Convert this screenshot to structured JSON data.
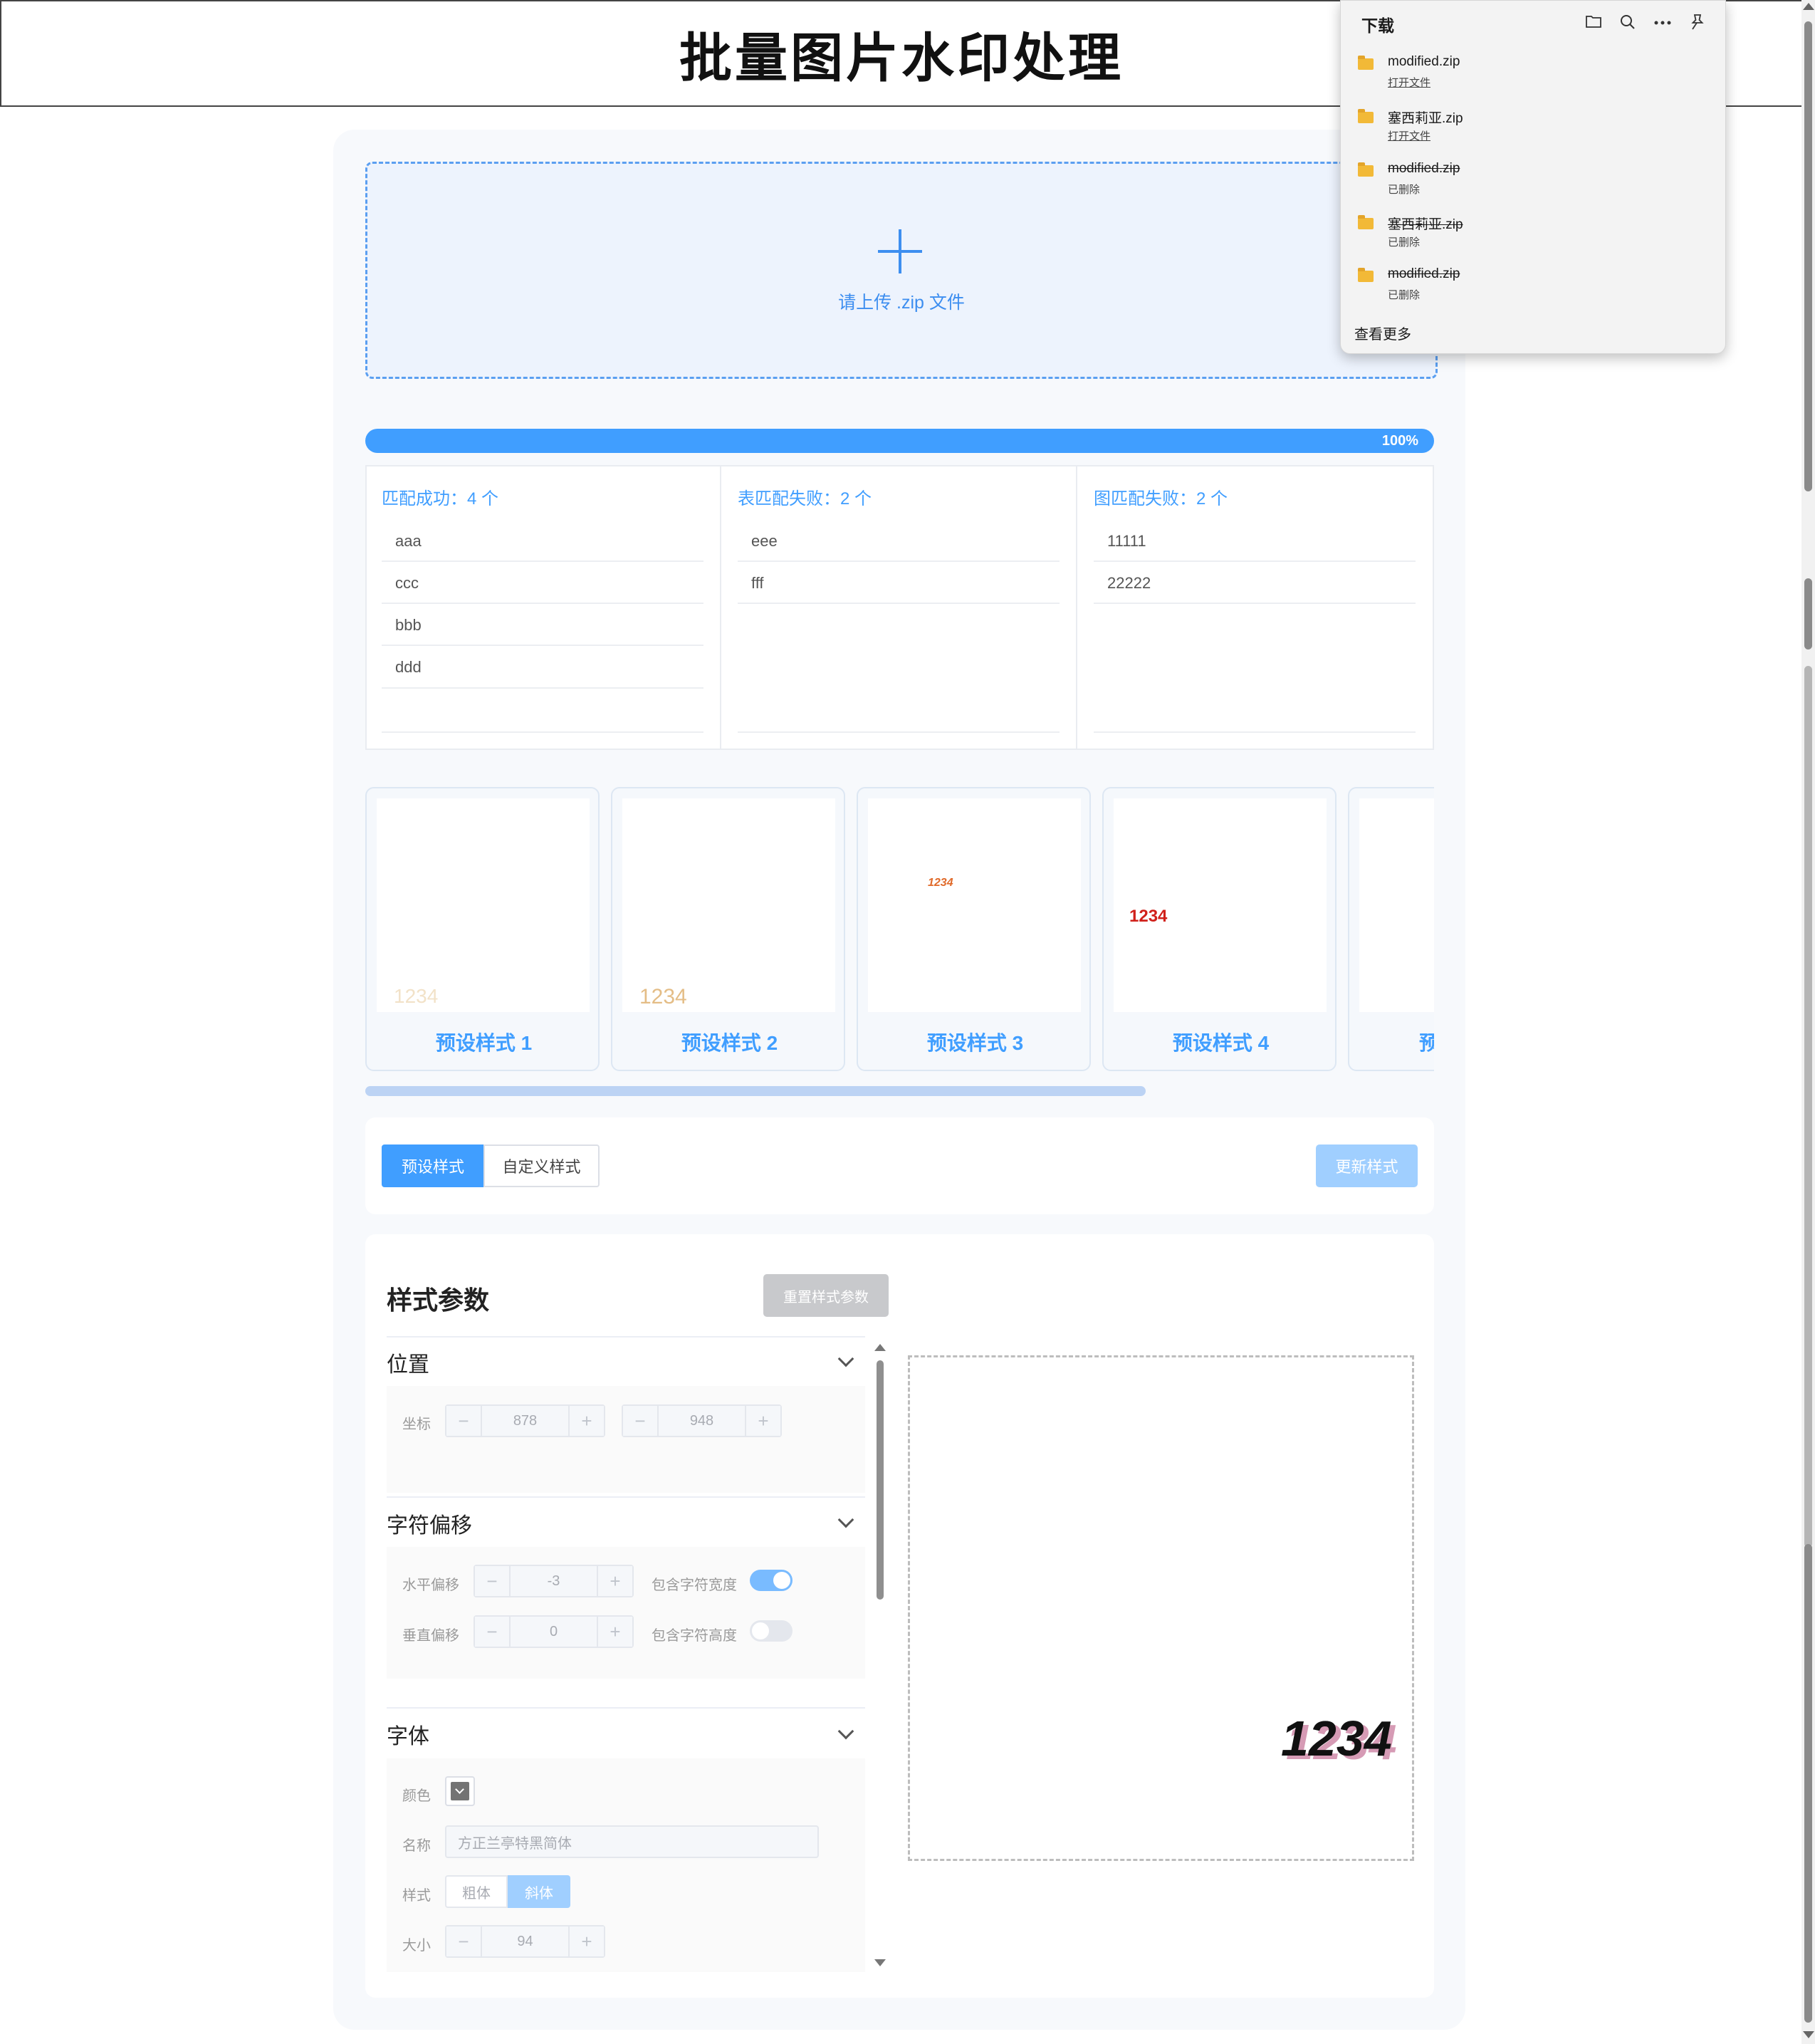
{
  "page": {
    "title": "批量图片水印处理"
  },
  "upload": {
    "text": "请上传 .zip 文件"
  },
  "progress": {
    "percent": 100,
    "label": "100%"
  },
  "match": {
    "success": {
      "title": "匹配成功：4 个",
      "items": [
        "aaa",
        "ccc",
        "bbb",
        "ddd"
      ]
    },
    "table_fail": {
      "title": "表匹配失败：2 个",
      "items": [
        "eee",
        "fff"
      ]
    },
    "image_fail": {
      "title": "图匹配失败：2 个",
      "items": [
        "11111",
        "22222"
      ]
    }
  },
  "presets": [
    {
      "label": "预设样式 1",
      "watermark": "1234"
    },
    {
      "label": "预设样式 2",
      "watermark": "1234"
    },
    {
      "label": "预设样式 3",
      "watermark": "1234"
    },
    {
      "label": "预设样式 4",
      "watermark": "1234"
    },
    {
      "label": "预"
    }
  ],
  "tabs": {
    "preset": "预设样式",
    "custom": "自定义样式",
    "active": "preset"
  },
  "update_button": "更新样式",
  "params": {
    "title": "样式参数",
    "reset_button": "重置样式参数",
    "position": {
      "title": "位置",
      "coord_label": "坐标",
      "x": "878",
      "y": "948"
    },
    "char_offset": {
      "title": "字符偏移",
      "h_label": "水平偏移",
      "h_value": "-3",
      "v_label": "垂直偏移",
      "v_value": "0",
      "include_width_label": "包含字符宽度",
      "include_width": true,
      "include_height_label": "包含字符高度",
      "include_height": false
    },
    "font": {
      "title": "字体",
      "color_label": "颜色",
      "color": "#737373",
      "name_label": "名称",
      "name_placeholder": "方正兰亭特黑简体",
      "style_label": "样式",
      "bold": "粗体",
      "italic": "斜体",
      "italic_active": true,
      "size_label": "大小",
      "size": "94"
    }
  },
  "preview": {
    "watermark": "1234"
  },
  "downloads": {
    "title": "下载",
    "items": [
      {
        "name": "modified.zip",
        "status": "打开文件",
        "deleted": false
      },
      {
        "name": "塞西莉亚.zip",
        "status": "打开文件",
        "deleted": false
      },
      {
        "name": "modified.zip",
        "status": "已删除",
        "deleted": true
      },
      {
        "name": "塞西莉亚.zip",
        "status": "已删除",
        "deleted": true
      },
      {
        "name": "modified.zip",
        "status": "已删除",
        "deleted": true
      }
    ],
    "more": "查看更多"
  },
  "icons": {
    "folder": "folder-icon",
    "search": "search-icon",
    "more": "more-icon",
    "pin": "pin-icon",
    "plus": "plus-icon",
    "chevron": "chevron-down-icon"
  },
  "colors": {
    "accent": "#409eff",
    "accent_light": "#a0cfff"
  }
}
